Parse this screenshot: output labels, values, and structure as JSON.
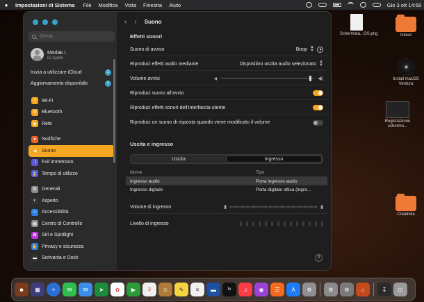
{
  "menubar": {
    "app_name": "Impostazioni di Sistema",
    "items": [
      "File",
      "Modifica",
      "Vista",
      "Finestra",
      "Aiuto"
    ],
    "clock": "Gio 3 ott  14:58"
  },
  "sidebar": {
    "search_placeholder": "Cerca",
    "user_name": "Morlak I",
    "user_sub": "ID Apple",
    "notices": [
      {
        "label": "Inizia a utilizzare iCloud",
        "badge": "1"
      },
      {
        "label": "Aggiornamento disponibile",
        "badge": "1"
      }
    ],
    "items": [
      {
        "label": "Wi-Fi",
        "icon": "wifi-icon",
        "color": "#f5a623"
      },
      {
        "label": "Bluetooth",
        "icon": "bluetooth-icon",
        "color": "#f5a623"
      },
      {
        "label": "Rete",
        "icon": "globe-icon",
        "color": "#f5a623"
      },
      {
        "label": "Notifiche",
        "icon": "bell-icon",
        "color": "#e8622c"
      },
      {
        "label": "Suono",
        "icon": "speaker-icon",
        "color": "#f5a623",
        "selected": true
      },
      {
        "label": "Full immersion",
        "icon": "moon-icon",
        "color": "#5b5bd6"
      },
      {
        "label": "Tempo di utilizzo",
        "icon": "hourglass-icon",
        "color": "#5b5bd6"
      },
      {
        "label": "Generali",
        "icon": "gear-icon",
        "color": "#8e8e93"
      },
      {
        "label": "Aspetto",
        "icon": "appearance-icon",
        "color": "#333333"
      },
      {
        "label": "Accessibilità",
        "icon": "accessibility-icon",
        "color": "#2f7de1"
      },
      {
        "label": "Centro di Controllo",
        "icon": "control-center-icon",
        "color": "#8e8e93"
      },
      {
        "label": "Siri e Spotlight",
        "icon": "siri-icon",
        "color": "#c03ad9"
      },
      {
        "label": "Privacy e sicurezza",
        "icon": "hand-icon",
        "color": "#2f7de1"
      },
      {
        "label": "Scrivania e Dock",
        "icon": "dock-icon",
        "color": "#333333"
      }
    ]
  },
  "main": {
    "title": "Suono",
    "effects_heading": "Effetti sonori",
    "alert_sound_label": "Suono di avviso",
    "alert_sound_value": "Boop",
    "play_effects_label": "Riproduci effetti audio mediante",
    "play_effects_value": "Dispositivo uscita audio selezionato",
    "alert_volume_label": "Volume avvisi",
    "alert_volume_fraction": 0.97,
    "startup_sound_label": "Riproduci suono all’avvio",
    "startup_sound_on": true,
    "ui_sounds_label": "Riproduci effetti sonori dell’interfaccia utente",
    "ui_sounds_on": true,
    "volume_feedback_label": "Riproduci un suono di risposta quando viene modificato il volume",
    "volume_feedback_on": false,
    "io_heading": "Uscita e ingresso",
    "tabs": [
      "Uscita",
      "Ingresso"
    ],
    "active_tab": "Ingresso",
    "table": {
      "headers": [
        "Nome",
        "Tipo"
      ],
      "rows": [
        [
          "Ingresso audio",
          "Porta ingresso audio"
        ],
        [
          "Ingresso digitale",
          "Porta digitale ottica (ingre..."
        ]
      ]
    },
    "input_volume_label": "Volume di ingresso",
    "input_level_label": "Livello di ingresso",
    "help": "?"
  },
  "desktop": {
    "icons": [
      {
        "label": "Schermata...OS.png",
        "type": "doc"
      },
      {
        "label": "Icloud",
        "type": "folder"
      },
      {
        "label": "Install macOS Ventura",
        "type": "disc"
      },
      {
        "label": "Registrazione schermo...",
        "type": "screen"
      },
      {
        "label": "Creatività",
        "type": "folder"
      }
    ]
  }
}
